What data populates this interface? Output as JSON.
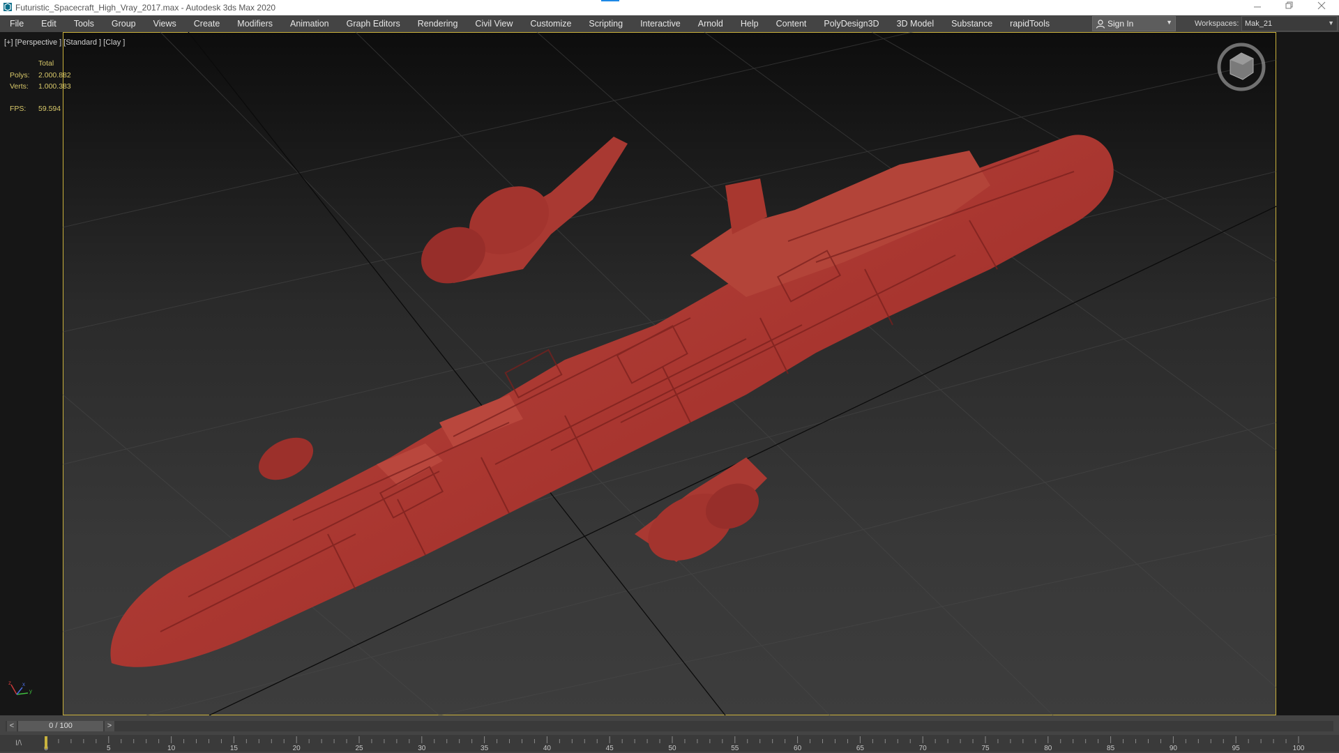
{
  "window": {
    "title": "Futuristic_Spacecraft_High_Vray_2017.max - Autodesk 3ds Max 2020",
    "controls": [
      "minimize",
      "restore",
      "close"
    ],
    "accent_color": "#1e88e5"
  },
  "menu": {
    "items": [
      "File",
      "Edit",
      "Tools",
      "Group",
      "Views",
      "Create",
      "Modifiers",
      "Animation",
      "Graph Editors",
      "Rendering",
      "Civil View",
      "Customize",
      "Scripting",
      "Interactive",
      "Arnold",
      "Help",
      "Content",
      "PolyDesign3D",
      "3D Model",
      "Substance",
      "rapidTools"
    ],
    "sign_in_label": "Sign In",
    "workspaces_label": "Workspaces:",
    "workspace_value": "Mak_21"
  },
  "viewport": {
    "label": "[+] [Perspective ] [Standard ] [Clay ]",
    "border_color": "#cbb23c",
    "model_color": "#a8352f",
    "stats": {
      "header": "Total",
      "polys_label": "Polys:",
      "polys_value": "2.000.882",
      "verts_label": "Verts:",
      "verts_value": "1.000.383",
      "fps_label": "FPS:",
      "fps_value": "59.594"
    },
    "axis_labels": [
      "z",
      "x",
      "y"
    ]
  },
  "timeline": {
    "frame_display": "0 / 100",
    "prev_label": "<",
    "next_label": ">",
    "key_mode_label": "I/\\",
    "ticks": [
      "0",
      "5",
      "10",
      "15",
      "20",
      "25",
      "30",
      "35",
      "40",
      "45",
      "50",
      "55",
      "60",
      "65",
      "70",
      "75",
      "80",
      "85",
      "90",
      "95",
      "100"
    ],
    "current_frame": 0,
    "total_frames": 100
  }
}
